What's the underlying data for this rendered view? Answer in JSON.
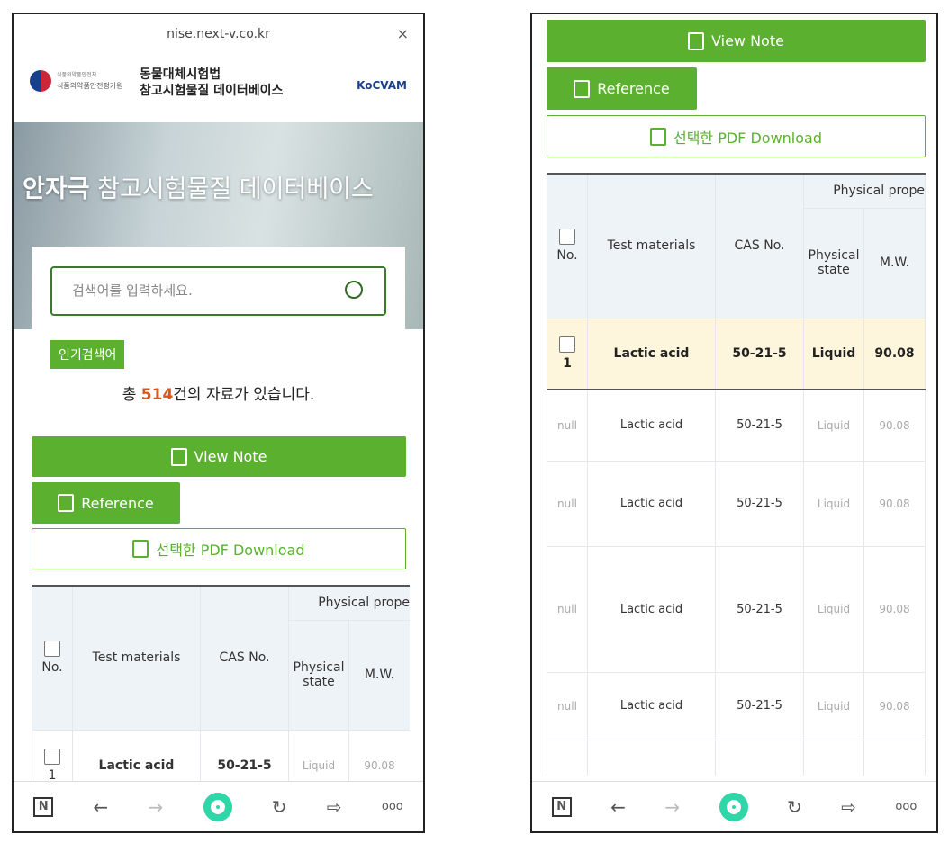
{
  "browser": {
    "url": "nise.next-v.co.kr",
    "close": "×"
  },
  "header": {
    "agency": "식품의약품안전처",
    "agency_sub": "식품의약품안전평가원",
    "title_line1": "동물대체시험법",
    "title_line2": "참고시험물질 데이터베이스",
    "partner_logo": "KoCVAM"
  },
  "hero": {
    "title_bold": "안자극",
    "title_rest": " 참고시험물질 데이터베이스"
  },
  "search": {
    "placeholder": "검색어를 입력하세요.",
    "popular_label": "인기검색어"
  },
  "summary": {
    "prefix": "총 ",
    "count": "514",
    "suffix": "건의 자료가 있습니다."
  },
  "buttons": {
    "view_note": "View Note",
    "reference": "Reference",
    "pdf_download": "선택한 PDF Download"
  },
  "table": {
    "headers": {
      "no": "No.",
      "test_materials": "Test materials",
      "cas": "CAS No.",
      "group": "Physical prope",
      "physical_state": "Physical state",
      "mw": "M.W."
    },
    "selected_row": {
      "no": "1",
      "material": "Lactic acid",
      "cas": "50-21-5",
      "state": "Liquid",
      "mw": "90.08"
    },
    "rows": [
      {
        "no": "null",
        "material": "Lactic acid",
        "cas": "50-21-5",
        "state": "Liquid",
        "mw": "90.08"
      },
      {
        "no": "null",
        "material": "Lactic acid",
        "cas": "50-21-5",
        "state": "Liquid",
        "mw": "90.08"
      },
      {
        "no": "null",
        "material": "Lactic acid",
        "cas": "50-21-5",
        "state": "Liquid",
        "mw": "90.08"
      },
      {
        "no": "null",
        "material": "Lactic acid",
        "cas": "50-21-5",
        "state": "Liquid",
        "mw": "90.08"
      }
    ]
  },
  "nav": {
    "n": "N",
    "back": "←",
    "forward": "→",
    "reload": "↻",
    "share": "⇨",
    "more": "ooo"
  },
  "colors": {
    "accent": "#5bb12f",
    "count": "#d8561c",
    "selected_row": "#fdf6dc"
  }
}
